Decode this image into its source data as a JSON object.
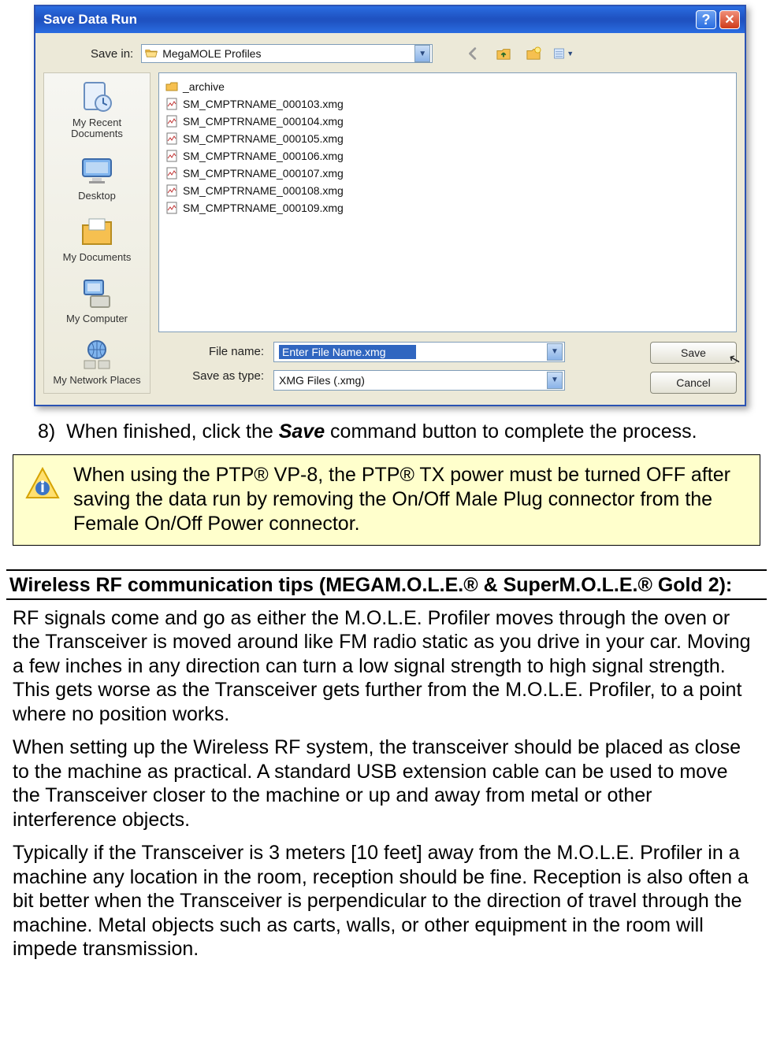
{
  "dialog": {
    "title": "Save Data Run",
    "help_char": "?",
    "close_char": "✕",
    "save_in_label": "Save in:",
    "save_in_value": "MegaMOLE Profiles",
    "places": [
      {
        "label": "My Recent Documents",
        "icon": "recent"
      },
      {
        "label": "Desktop",
        "icon": "desktop"
      },
      {
        "label": "My Documents",
        "icon": "mydocs"
      },
      {
        "label": "My Computer",
        "icon": "mycomputer"
      },
      {
        "label": "My Network Places",
        "icon": "network"
      }
    ],
    "files": [
      {
        "name": "_archive",
        "type": "folder"
      },
      {
        "name": "SM_CMPTRNAME_000103.xmg",
        "type": "file"
      },
      {
        "name": "SM_CMPTRNAME_000104.xmg",
        "type": "file"
      },
      {
        "name": "SM_CMPTRNAME_000105.xmg",
        "type": "file"
      },
      {
        "name": "SM_CMPTRNAME_000106.xmg",
        "type": "file"
      },
      {
        "name": "SM_CMPTRNAME_000107.xmg",
        "type": "file"
      },
      {
        "name": "SM_CMPTRNAME_000108.xmg",
        "type": "file"
      },
      {
        "name": "SM_CMPTRNAME_000109.xmg",
        "type": "file"
      }
    ],
    "file_name_label": "File name:",
    "file_name_value": "Enter File Name.xmg",
    "save_type_label": "Save as type:",
    "save_type_value": "XMG Files (.xmg)",
    "save_button": "Save",
    "cancel_button": "Cancel"
  },
  "step": {
    "number": "8)",
    "before": "When finished, click the ",
    "bold": "Save",
    "after": " command button to complete the process."
  },
  "note": {
    "text": "When using the PTP® VP-8, the PTP® TX power must be turned OFF after saving the data   run by removing the On/Off Male Plug connector from the Female On/Off Power connector."
  },
  "section_heading": "Wireless RF communication tips (MEGAM.O.L.E.® & SuperM.O.L.E.® Gold 2):",
  "paragraphs": {
    "p1": "RF signals come and go as either the M.O.L.E. Profiler moves through the oven or the Transceiver is moved around like FM radio static as you drive in your car. Moving a few inches in any direction can turn a low signal strength to high signal strength. This gets worse as the Transceiver gets further from the M.O.L.E. Profiler, to a point where no position works.",
    "p2": "When setting up the Wireless RF system, the transceiver should be placed as close to the machine as practical. A standard USB extension cable can be used to move the Transceiver closer to the machine or up and away from metal or other interference objects.",
    "p3": "Typically if the Transceiver is 3 meters [10 feet] away from the M.O.L.E. Profiler in a machine any location in the room, reception should be fine. Reception is also often a bit better when the Transceiver is perpendicular to the direction of travel through the machine. Metal objects such as carts, walls, or other equipment in the room will impede transmission."
  }
}
